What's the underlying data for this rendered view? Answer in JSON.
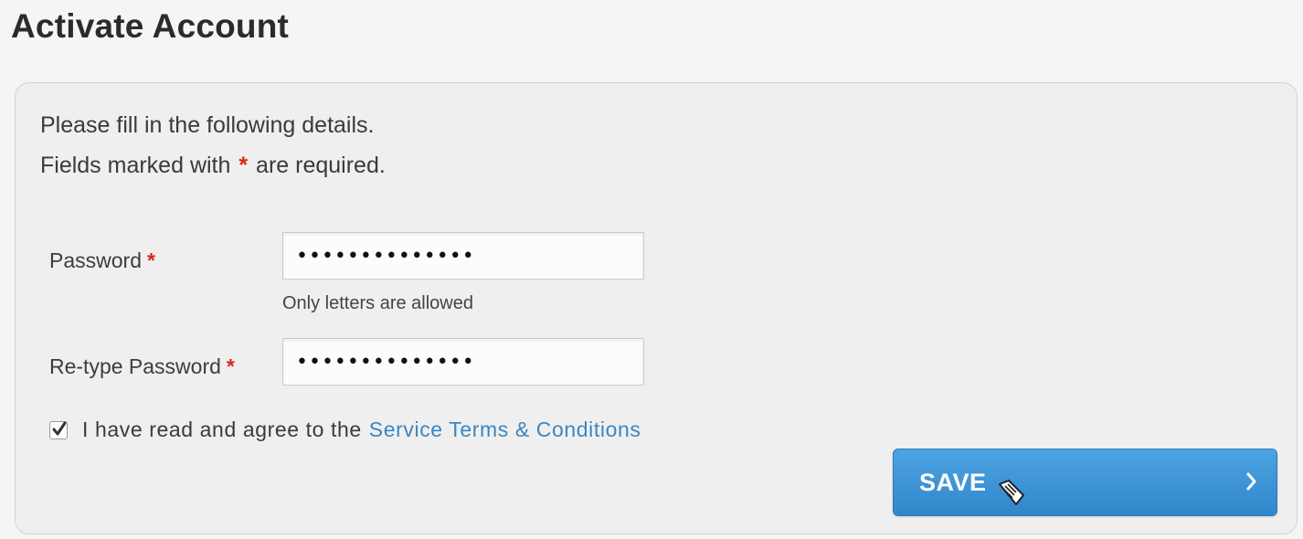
{
  "header": {
    "title": "Activate Account"
  },
  "form": {
    "intro_line1": "Please fill in the following details.",
    "intro_line2_before": "Fields marked with",
    "required_marker": "*",
    "intro_line2_after": "are required.",
    "password": {
      "label": "Password",
      "value": "••••••••••••••",
      "hint": "Only letters are allowed"
    },
    "retype_password": {
      "label": "Re-type Password",
      "value": "••••••••••••••"
    },
    "terms": {
      "checked": true,
      "text": "I have read and agree to the",
      "link_text": "Service Terms & Conditions"
    },
    "save_button": {
      "label": "SAVE",
      "icon": "chevron-right-icon"
    }
  },
  "colors": {
    "required": "#d9261c",
    "link": "#3b87c2",
    "button": "#3a92d4"
  }
}
